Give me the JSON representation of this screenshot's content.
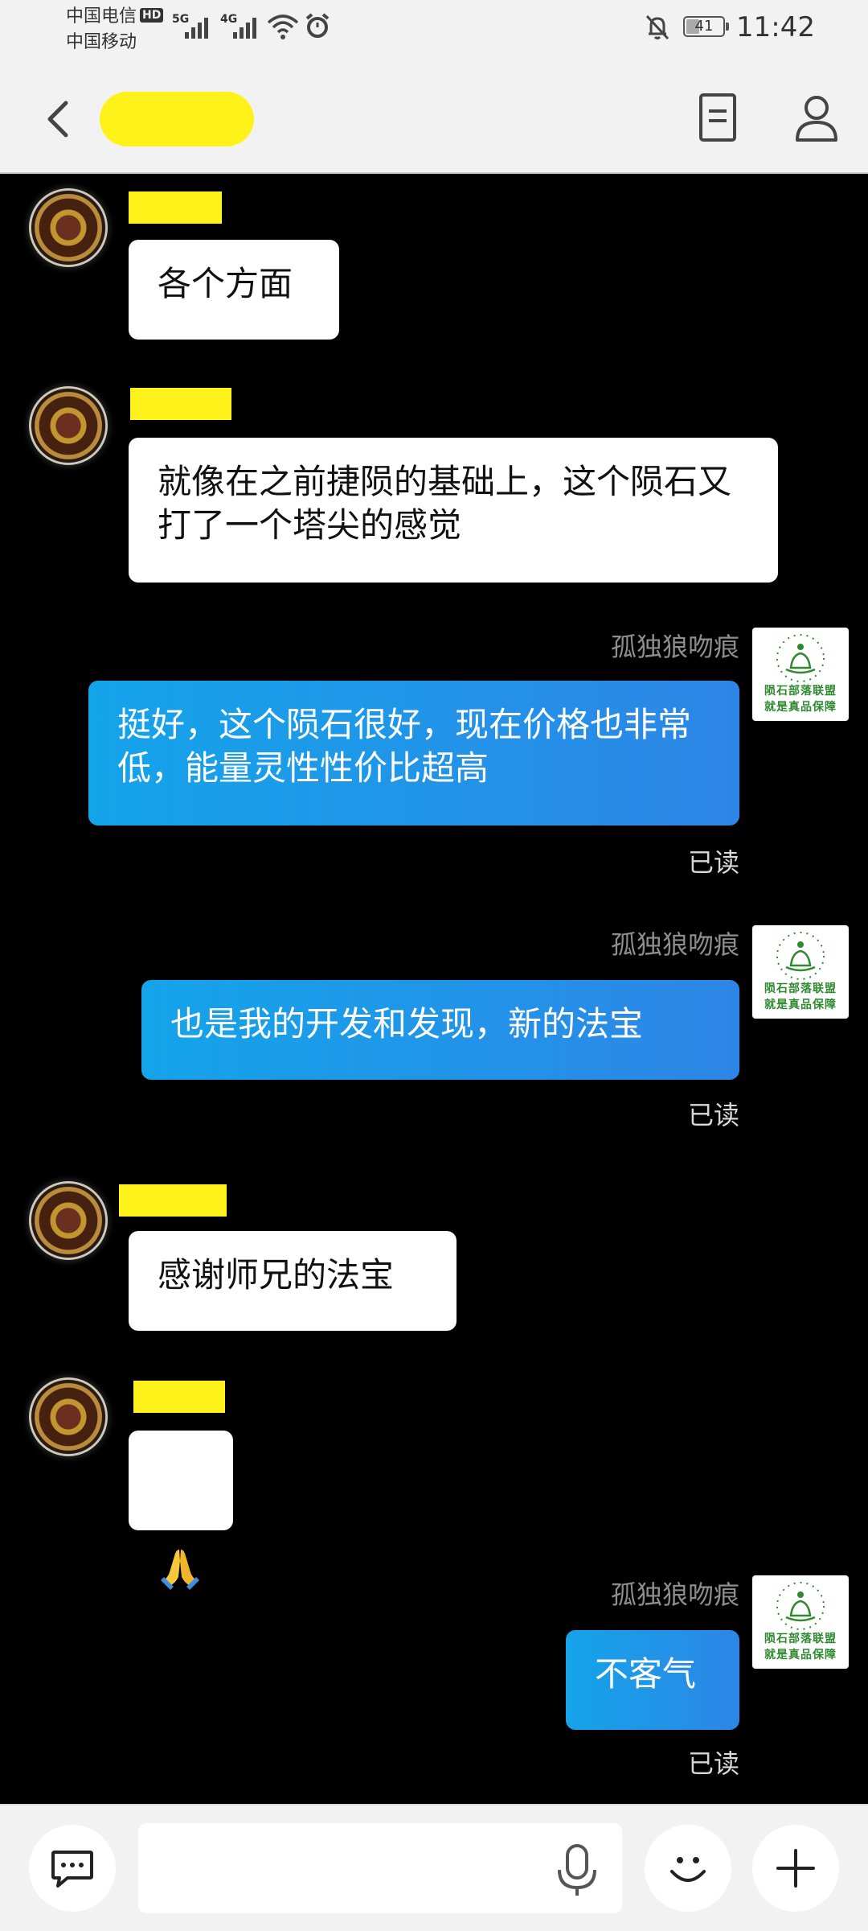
{
  "status_bar": {
    "carrier1": "中国电信",
    "carrier2": "中国移动",
    "hd": "HD",
    "net1": "5G",
    "net2": "4G",
    "battery": "41",
    "battery_level": 0.41,
    "time": "11:42"
  },
  "header": {
    "back_icon": "chevron-left-icon",
    "details_icon": "document-icon",
    "profile_icon": "person-icon"
  },
  "messages": [
    {
      "side": "in",
      "text": "各个方面"
    },
    {
      "side": "in",
      "text": "就像在之前捷陨的基础上，这个陨石又打了一个塔尖的感觉"
    },
    {
      "side": "out",
      "sender": "孤独狼吻痕",
      "text": "挺好，这个陨石很好，现在价格也非常低，能量灵性性价比超高",
      "status": "已读"
    },
    {
      "side": "out",
      "sender": "孤独狼吻痕",
      "text": "也是我的开发和发现，新的法宝",
      "status": "已读"
    },
    {
      "side": "in",
      "text": "感谢师兄的法宝"
    },
    {
      "side": "in",
      "emoji": "folded-hands-icon"
    },
    {
      "side": "out",
      "sender": "孤独狼吻痕",
      "text": "不客气",
      "status": "已读"
    }
  ],
  "avatar_right": {
    "line1": "陨石部落联盟",
    "line2": "就是真品保障"
  },
  "input_bar": {
    "placeholder": "",
    "chat_icon": "chat-bubble-icon",
    "mic_icon": "microphone-icon",
    "emoji_icon": "smiley-icon",
    "plus_icon": "plus-icon"
  },
  "colors": {
    "outgoing_bubble": "#1d97e8",
    "incoming_bubble": "#ffffff",
    "background": "#000000",
    "bar_background": "#f2f2f2",
    "redaction": "#fff21a"
  }
}
